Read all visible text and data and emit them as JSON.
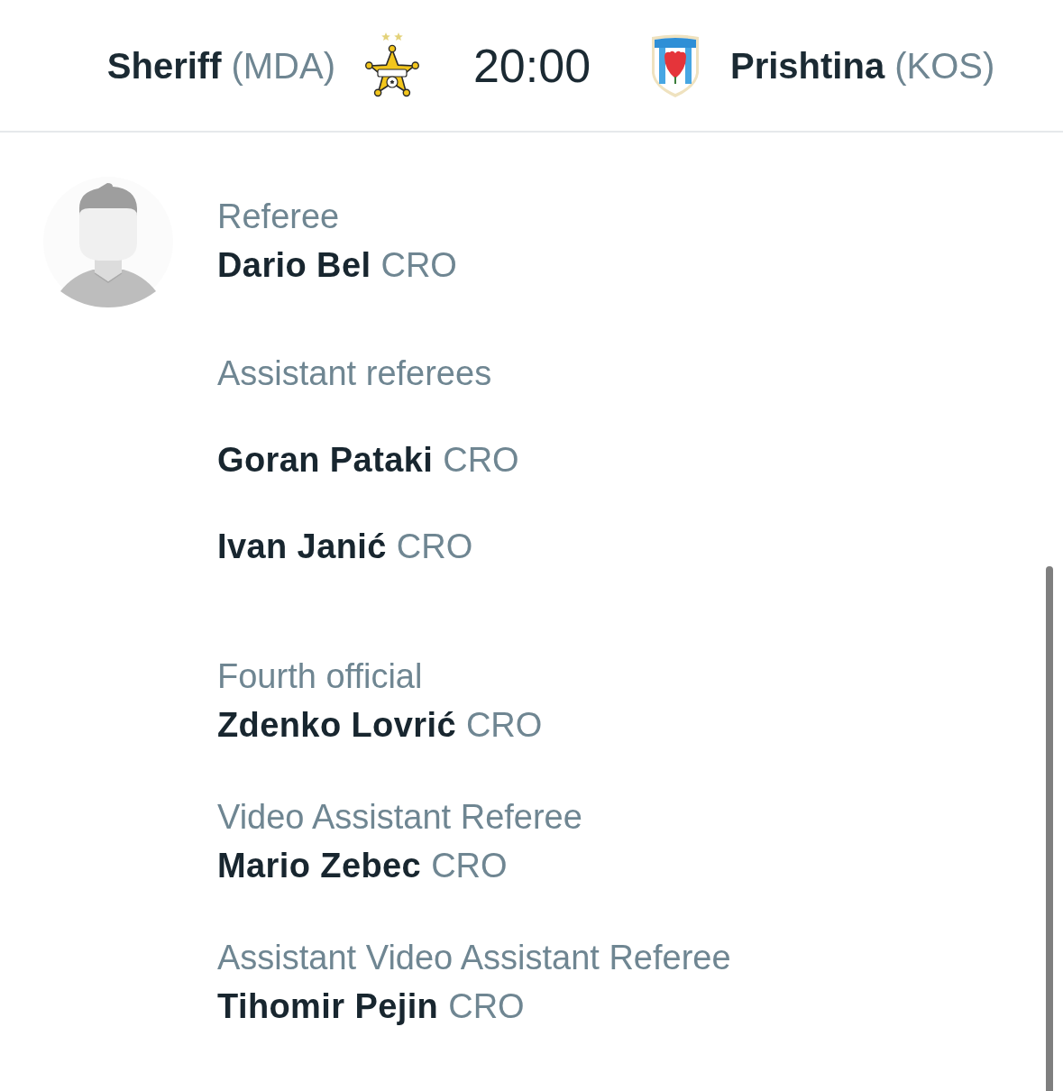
{
  "match": {
    "home": {
      "name": "Sheriff",
      "country": "(MDA)"
    },
    "kickoff": "20:00",
    "away": {
      "name": "Prishtina",
      "country": "(KOS)"
    }
  },
  "referee": {
    "role": "Referee",
    "name": "Dario Bel",
    "nationality": "CRO"
  },
  "sections": [
    {
      "kind": "spaced",
      "role": "Assistant referees",
      "people": [
        {
          "name": "Goran Pataki",
          "nationality": "CRO"
        },
        {
          "name": "Ivan Janić",
          "nationality": "CRO"
        }
      ]
    },
    {
      "kind": "stacked",
      "role": "Fourth official",
      "people": [
        {
          "name": "Zdenko Lovrić",
          "nationality": "CRO"
        }
      ]
    },
    {
      "kind": "stacked",
      "role": "Video Assistant Referee",
      "people": [
        {
          "name": "Mario Zebec",
          "nationality": "CRO"
        }
      ]
    },
    {
      "kind": "stacked",
      "role": "Assistant Video Assistant Referee",
      "people": [
        {
          "name": "Tihomir Pejin",
          "nationality": "CRO"
        }
      ]
    }
  ]
}
